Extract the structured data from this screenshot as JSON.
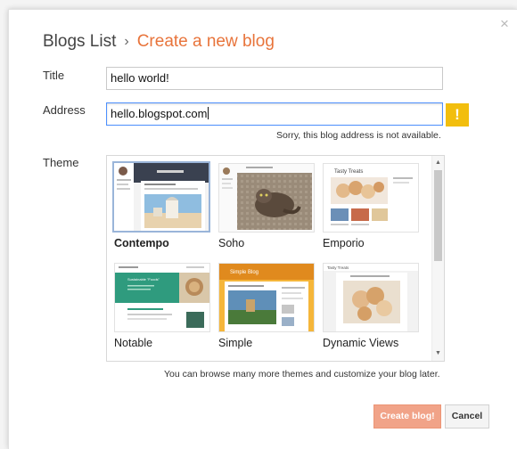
{
  "dialog": {
    "close_glyph": "×",
    "breadcrumb": {
      "parent": "Blogs List",
      "separator": "›",
      "current": "Create a new blog"
    }
  },
  "form": {
    "title": {
      "label": "Title",
      "value": "hello world!"
    },
    "address": {
      "label": "Address",
      "value": "hello.blogspot.com",
      "warning_glyph": "!",
      "error": "Sorry, this blog address is not available."
    },
    "theme": {
      "label": "Theme",
      "selected": "Contempo",
      "options": [
        {
          "name": "Contempo"
        },
        {
          "name": "Soho"
        },
        {
          "name": "Emporio",
          "thumb_title": "Tasty Treats"
        },
        {
          "name": "Notable",
          "thumb_title": "Sustainable \"Foods\""
        },
        {
          "name": "Simple",
          "thumb_title": "Simple Blog"
        },
        {
          "name": "Dynamic Views",
          "thumb_title": "Tasty Treats"
        }
      ]
    }
  },
  "hint": "You can browse many more themes and customize your blog later.",
  "buttons": {
    "create": "Create blog!",
    "cancel": "Cancel"
  },
  "colors": {
    "accent": "#e8743b",
    "warning": "#f2be0d",
    "create_button": "#f1a388",
    "focus": "#4d90fe"
  },
  "icons": {
    "close": "close-icon",
    "warning": "warning-icon",
    "scroll_up": "scroll-up-icon",
    "scroll_down": "scroll-down-icon"
  }
}
